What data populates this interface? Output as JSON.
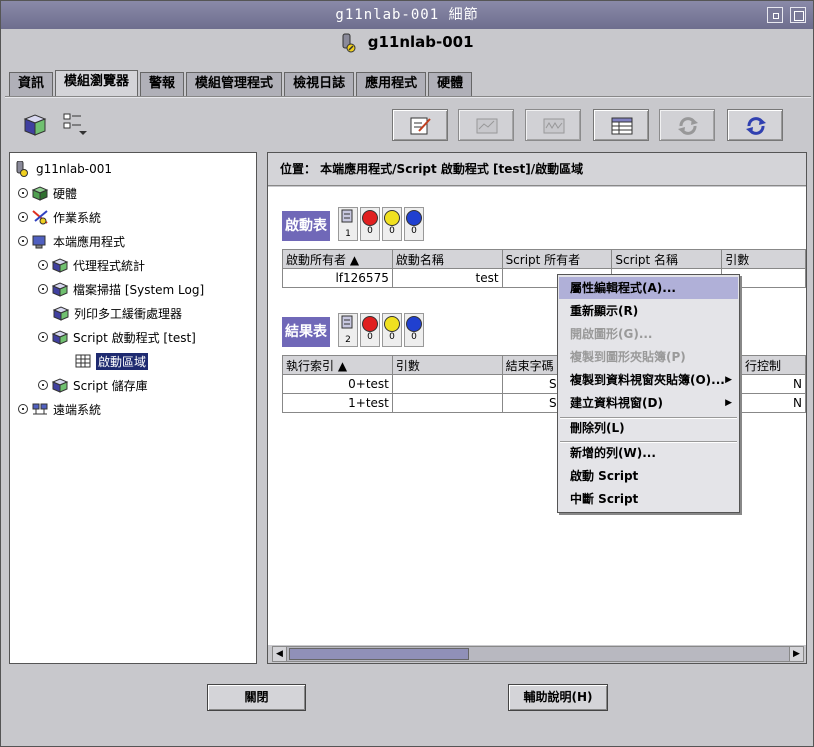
{
  "window": {
    "title": "g11nlab-001 細節"
  },
  "host": {
    "name": "g11nlab-001"
  },
  "tabs": [
    {
      "label": "資訊"
    },
    {
      "label": "模組瀏覽器"
    },
    {
      "label": "警報"
    },
    {
      "label": "模組管理程式"
    },
    {
      "label": "檢視日誌"
    },
    {
      "label": "應用程式"
    },
    {
      "label": "硬體"
    }
  ],
  "tree": {
    "nodes": [
      {
        "label": "g11nlab-001"
      },
      {
        "label": "硬體"
      },
      {
        "label": "作業系統"
      },
      {
        "label": "本端應用程式"
      },
      {
        "label": "代理程式統計"
      },
      {
        "label": "檔案掃描 [System Log]"
      },
      {
        "label": "列印多工緩衝處理器"
      },
      {
        "label": "Script 啟動程式 [test]"
      },
      {
        "label": "啟動區域"
      },
      {
        "label": "Script 儲存庫"
      },
      {
        "label": "遠端系統"
      }
    ]
  },
  "location": {
    "text": "位置： 本端應用程式/Script 啟動程式 [test]/啟動區域"
  },
  "launch": {
    "title": "啟動表",
    "counts": [
      "1",
      "0",
      "0",
      "0"
    ],
    "columns": [
      "啟動所有者 ▲",
      "啟動名稱",
      "Script 所有者",
      "Script 名稱",
      "引數"
    ],
    "rows": [
      [
        "lf126575",
        "test",
        "",
        "",
        ""
      ]
    ]
  },
  "result": {
    "title": "結果表",
    "counts": [
      "2",
      "0",
      "0",
      "0"
    ],
    "columns": [
      "執行索引 ▲",
      "引數",
      "結束字碼",
      "",
      "行控制"
    ],
    "rows": [
      [
        "0+test",
        "",
        "S",
        "",
        "N"
      ],
      [
        "1+test",
        "",
        "S",
        "",
        "N"
      ]
    ]
  },
  "context_menu": {
    "items": [
      {
        "label": "屬性編輯程式(A)..."
      },
      {
        "label": "重新顯示(R)"
      },
      {
        "label": "開啟圖形(G)..."
      },
      {
        "label": "複製到圖形夾貼簿(P)"
      },
      {
        "label": "複製到資料視窗夾貼簿(O)..."
      },
      {
        "label": "建立資料視窗(D)"
      },
      {
        "label": "刪除列(L)"
      },
      {
        "label": "新增的列(W)..."
      },
      {
        "label": "啟動 Script"
      },
      {
        "label": "中斷 Script"
      }
    ]
  },
  "buttons": {
    "close": "關閉",
    "help": "輔助說明(H)"
  },
  "colors": {
    "title_bar": "#7a7a98",
    "section_header": "#7068b8",
    "selection": "#1e2a70"
  }
}
